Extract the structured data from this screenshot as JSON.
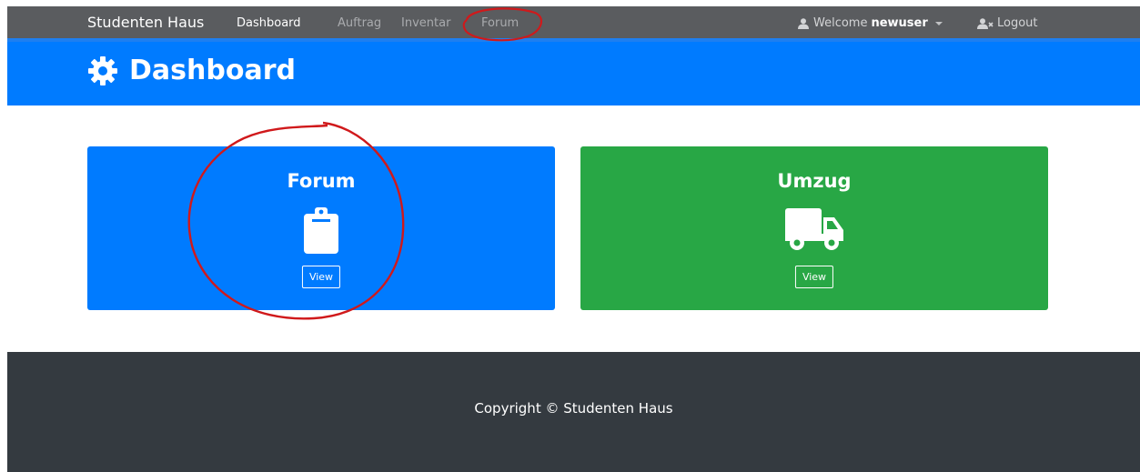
{
  "navbar": {
    "brand": "Studenten Haus",
    "links": [
      "Dashboard",
      "Auftrag",
      "Inventar",
      "Forum"
    ],
    "welcome_prefix": "Welcome",
    "username": "newuser",
    "logout": "Logout"
  },
  "header": {
    "title": "Dashboard",
    "icon": "cog-icon"
  },
  "cards": [
    {
      "title": "Forum",
      "icon": "clipboard-icon",
      "button": "View",
      "color": "#007bff"
    },
    {
      "title": "Umzug",
      "icon": "truck-icon",
      "button": "View",
      "color": "#28a745"
    }
  ],
  "footer": {
    "copyright": "Copyright © Studenten Haus"
  },
  "colors": {
    "navbar": "#5a5c5f",
    "header": "#007bff",
    "footer": "#343a40",
    "annotation": "#d0191b"
  }
}
